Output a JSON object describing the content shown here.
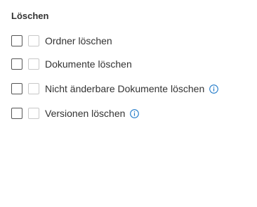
{
  "section": {
    "title": "Löschen"
  },
  "permissions": [
    {
      "label": "Ordner löschen",
      "checked": false,
      "secondary_checked": false,
      "has_info": false
    },
    {
      "label": "Dokumente löschen",
      "checked": false,
      "secondary_checked": false,
      "has_info": false
    },
    {
      "label": "Nicht änderbare Dokumente löschen",
      "checked": false,
      "secondary_checked": false,
      "has_info": true,
      "info_icon": "info-icon"
    },
    {
      "label": "Versionen löschen",
      "checked": false,
      "secondary_checked": false,
      "has_info": true,
      "info_icon": "info-icon"
    }
  ],
  "colors": {
    "text": "#333333",
    "checkbox_border": "#555555",
    "checkbox_secondary_border": "#c8c8c8",
    "info_accent": "#1e78c8"
  }
}
